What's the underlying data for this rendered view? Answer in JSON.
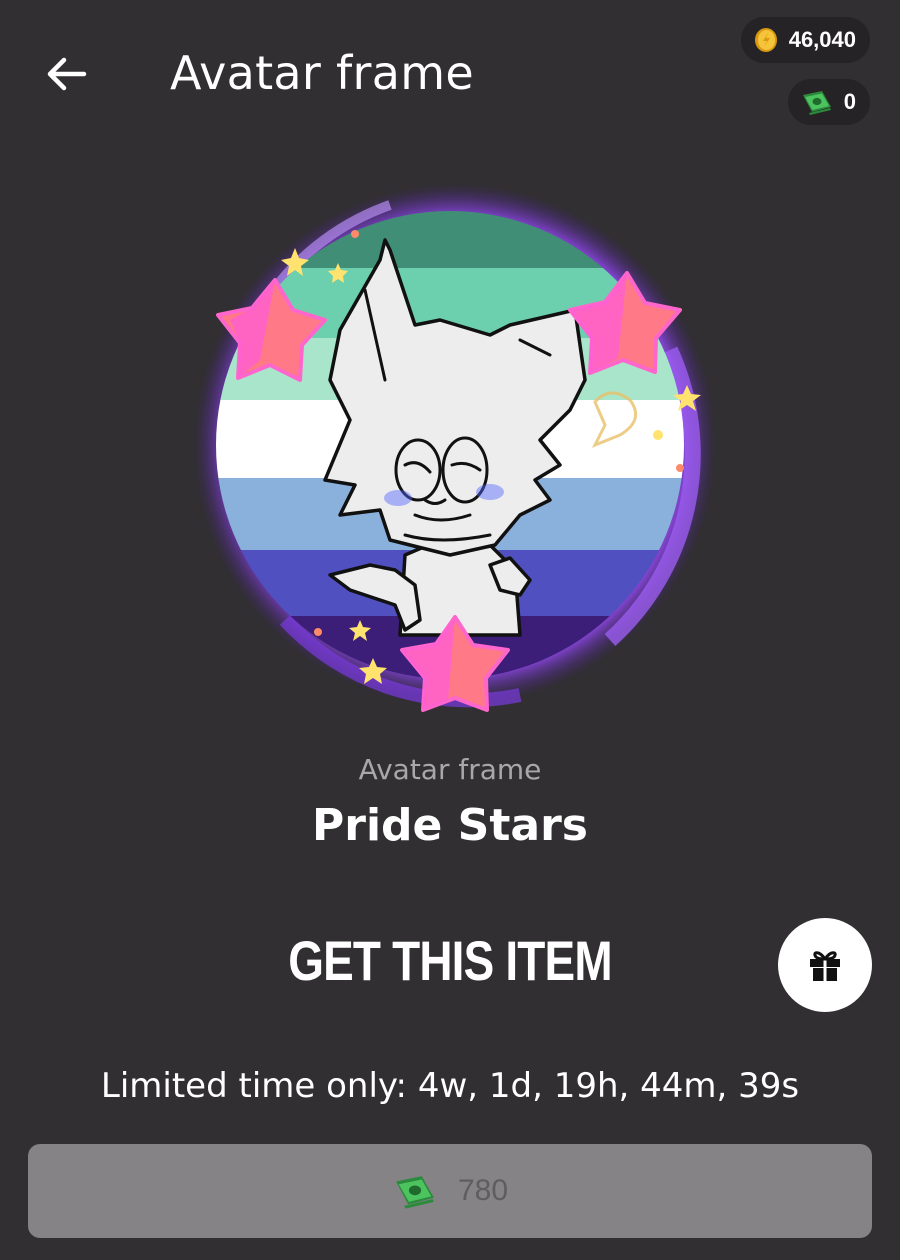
{
  "header": {
    "title": "Avatar frame",
    "back_icon": "arrow-left-icon"
  },
  "balances": {
    "coins": "46,040",
    "coin_icon": "gold-coin-icon",
    "cash": "0",
    "cash_icon": "banknote-icon"
  },
  "item": {
    "category": "Avatar frame",
    "name": "Pride Stars",
    "preview_image": "pride-flag-avatar-with-star-frame"
  },
  "actions": {
    "get_item_heading": "GET THIS ITEM",
    "gift_icon": "gift-icon",
    "limited_time": "Limited time only: 4w, 1d, 19h, 44m, 39s",
    "price": "780",
    "price_icon": "banknote-icon"
  },
  "colors": {
    "background": "#312f31",
    "pill_background": "#252325",
    "buy_button": "#858385",
    "flag_stripes": [
      "#3f8e75",
      "#6ccfae",
      "#a8e5cb",
      "#ffffff",
      "#8ab0dc",
      "#5050c0",
      "#3c1e78"
    ]
  }
}
